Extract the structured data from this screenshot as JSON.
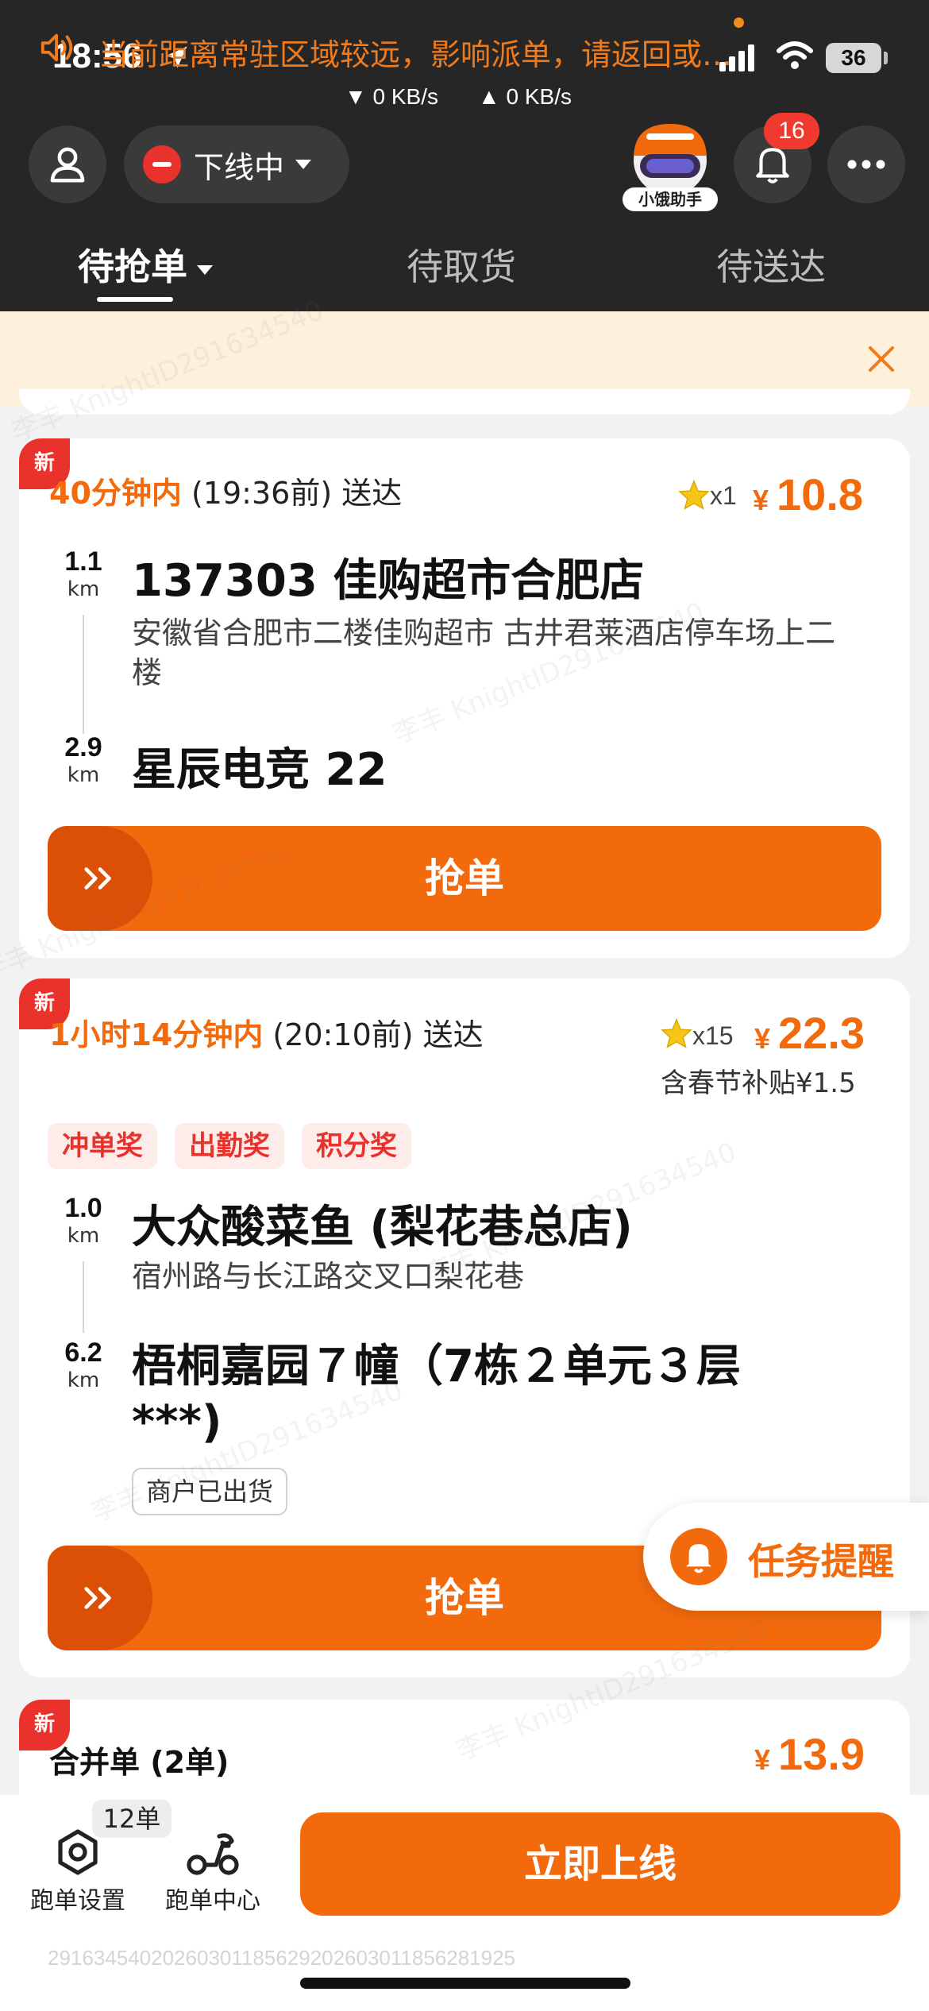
{
  "status_bar": {
    "time": "18:56",
    "battery": "36",
    "net_down": "▼ 0 KB/s",
    "net_up": "▲ 0 KB/s"
  },
  "header": {
    "online_status": "下线中",
    "assistant_label": "小饿助手",
    "notification_count": "16"
  },
  "tabs": [
    {
      "label": "待抢单",
      "active": true
    },
    {
      "label": "待取货",
      "active": false
    },
    {
      "label": "待送达",
      "active": false
    }
  ],
  "notice": {
    "text": "当前距离常驻区域较远，影响派单，请返回或…"
  },
  "orders": [
    {
      "new_tag": "新",
      "time_highlight": "40分钟内",
      "time_rest": "(19:36前) 送达",
      "multiplier": "x1",
      "currency": "¥",
      "price": "10.8",
      "pickup": {
        "distance": "1.1",
        "unit": "km",
        "name": "137303 佳购超市合肥店",
        "address": "安徽省合肥市二楼佳购超市 古井君莱酒店停车场上二楼"
      },
      "dropoff": {
        "distance": "2.9",
        "unit": "km",
        "name": "星辰电竞 22"
      },
      "grab_label": "抢单"
    },
    {
      "new_tag": "新",
      "time_highlight": "1小时14分钟内",
      "time_rest": "(20:10前) 送达",
      "multiplier": "x15",
      "currency": "¥",
      "price": "22.3",
      "subsidy": "含春节补贴¥1.5",
      "tags": [
        "冲单奖",
        "出勤奖",
        "积分奖"
      ],
      "pickup": {
        "distance": "1.0",
        "unit": "km",
        "name": "大众酸菜鱼 (梨花巷总店)",
        "address": "宿州路与长江路交叉口梨花巷"
      },
      "dropoff": {
        "distance": "6.2",
        "unit": "km",
        "name": "梧桐嘉园７幢（7栋２单元３层***)"
      },
      "merchant_status": "商户已出货",
      "grab_label": "抢单"
    },
    {
      "new_tag": "新",
      "title": "合并单 (2单)",
      "currency": "¥",
      "price": "13.9"
    }
  ],
  "reminder": {
    "label": "任务提醒"
  },
  "bottom": {
    "settings_label": "跑单设置",
    "settings_badge": "12单",
    "center_label": "跑单中心",
    "online_button": "立即上线",
    "footer_id": "29163454020260301185629202603011856281925"
  },
  "watermark": "李丰 KnightID291634540",
  "colors": {
    "accent": "#f26a0c",
    "red": "#e8322b",
    "header_bg": "#262626",
    "notice_bg": "#fdf1dc"
  }
}
